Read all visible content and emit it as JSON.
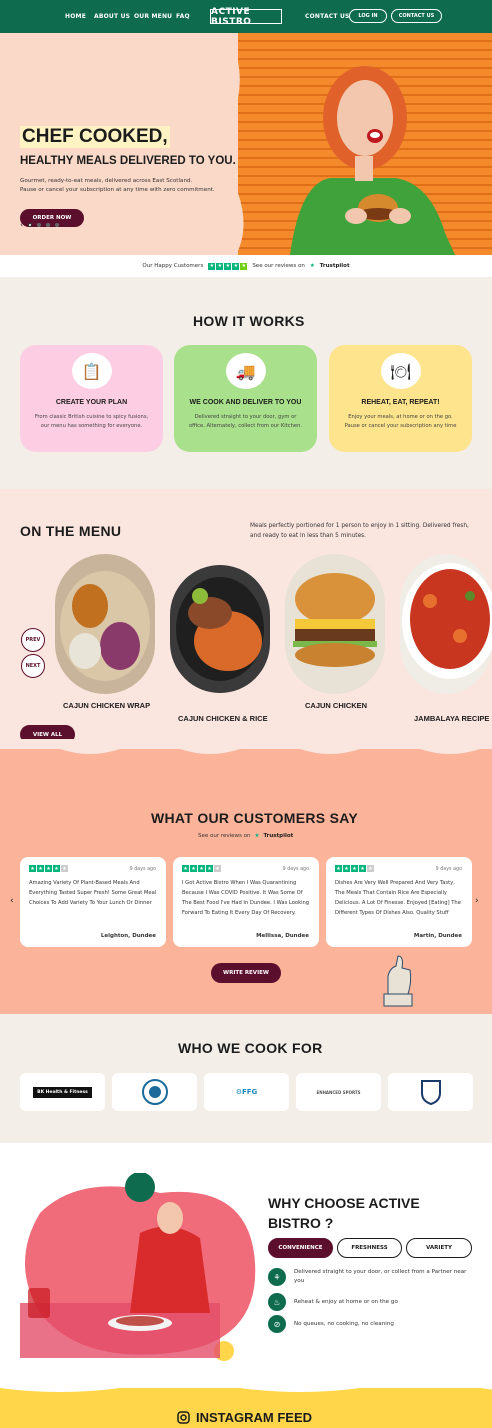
{
  "nav": {
    "links": [
      "HOME",
      "ABOUT US",
      "OUR MENU",
      "FAQ"
    ],
    "logo": "ACTIVE BISTRO",
    "contact": "CONTACT US",
    "login": "LOG IN",
    "contact_button": "CONTACT US"
  },
  "hero": {
    "title": "CHEF COOKED,",
    "subtitle": "HEALTHY MEALS DELIVERED TO YOU.",
    "line1": "Gourmet, ready-to-eat meals, delivered across East Scotland.",
    "line2": "Pause or cancel your subscription at any time with zero commitment.",
    "cta": "ORDER NOW",
    "prev_arrow": "‹",
    "next_arrow": "›"
  },
  "trust": {
    "happy": "Our Happy Customers",
    "see": "See our reviews on",
    "brand": "Trustpilot"
  },
  "how": {
    "title": "HOW IT WORKS",
    "cards": [
      {
        "title": "CREATE YOUR PLAN",
        "desc": "From classic British cuisine to spicy fusions, our menu has something for everyone.",
        "icon": "clipboard-icon",
        "bg": "#fccde3"
      },
      {
        "title": "WE COOK AND DELIVER TO YOU",
        "desc": "Delivered straight to your door, gym or office. Alternately, collect from our Kitchen.",
        "icon": "delivery-van-icon",
        "bg": "#a9e08b"
      },
      {
        "title": "REHEAT, EAT, REPEAT!",
        "desc": "Enjoy your meals, at home or on the go. Pause or cancel your subscription any time",
        "icon": "plate-cutlery-icon",
        "bg": "#fde48d"
      }
    ]
  },
  "menu": {
    "title": "ON THE MENU",
    "desc": "Meals perfectly portioned for 1 person to enjoy in 1 sitting. Delivered fresh, and ready to eat in less than 5 minutes.",
    "prev": "PREV",
    "next": "NEXT",
    "view_all": "VIEW ALL",
    "dishes": [
      "CAJUN CHICKEN WRAP",
      "CAJUN CHICKEN & RICE",
      "CAJUN CHICKEN",
      "JAMBALAYA RECIPE"
    ]
  },
  "reviews": {
    "title": "WHAT OUR CUSTOMERS SAY",
    "see": "See our reviews on",
    "brand": "Trustpilot",
    "write": "WRITE REVIEW",
    "items": [
      {
        "date": "9 days ago",
        "text": "Amazing Variety Of Plant-Based Meals And Everything Tasted Super Fresh! Some Great Meal Choices To Add Variety To Your Lunch Or Dinner",
        "name": "Leighton, Dundee"
      },
      {
        "date": "9 days ago",
        "text": "I Got Active Bistro When I Was Quarantining Because I Was COVID Positive. It Was Some Of The Best Food I've Had In Dundee. I Was Looking Forward To Eating It Every Day Of Recovery.",
        "name": "Mellissa, Dundee"
      },
      {
        "date": "9 days ago",
        "text": "Dishes Are Very Well Prepared And Very Tasty, The Meals That Contain Rice Are Especially Delicious. A Lot Of Finesse. Enjoyed [Eating] The Different Types Of Dishes Also. Quality Stuff",
        "name": "Martin, Dundee"
      }
    ]
  },
  "who": {
    "title": "WHO WE COOK FOR",
    "logos": [
      "BK Health & Fitness",
      "crest-logo",
      "FFG",
      "ENHANCED SPORTS",
      "shield-crest-logo"
    ]
  },
  "why": {
    "title_line1": "WHY CHOOSE ACTIVE",
    "title_line2": "BISTRO ?",
    "tabs": [
      "CONVENIENCE",
      "FRESHNESS",
      "VARIETY"
    ],
    "features": [
      "Delivered straight to your door, or collect from a Partner near you",
      "Reheat & enjoy at home or on the go",
      "No queues, no cooking, no cleaning"
    ]
  },
  "instagram": {
    "title": "INSTAGRAM FEED"
  },
  "colors": {
    "brand_green": "#0e6b4e",
    "burgundy": "#5b0f2c",
    "peach": "#fbb49a",
    "trustpilot": "#00b67a"
  }
}
